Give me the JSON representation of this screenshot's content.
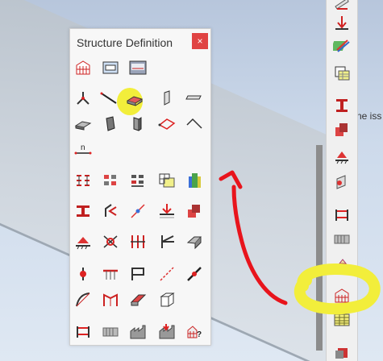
{
  "panel": {
    "title": "Structure Definition",
    "close_label": "×"
  },
  "background": {
    "partial_text": "ne iss"
  },
  "panel_tools": [
    "structure-model-icon",
    "section-view-icon",
    "rob-icon",
    "node-icon",
    "bar-icon",
    "slab-icon",
    "wall-icon",
    "panel-icon",
    "solid-slab-icon",
    "volumetric-icon",
    "beam-icon",
    "contour-icon",
    "edge-icon",
    "node-n-icon",
    "bar-sections-icon",
    "slab-sections-icon",
    "panel-sections-icon",
    "materials-icon",
    "layers-icon",
    "i-section-icon",
    "rotate-icon",
    "releases-icon",
    "loads-icon",
    "shell-icon",
    "supports-icon",
    "offsets-icon",
    "columns-icon",
    "angles-icon",
    "cut-icon",
    "link-icon",
    "piles-icon",
    "contour-panel-icon",
    "diagonal-icon",
    "rigid-link-icon",
    "arch-icon",
    "frame-icon",
    "slope-icon",
    "cube-icon",
    "calculations-icon",
    "grid-icon",
    "factory-icon",
    "factory-loads-icon",
    "help-structure-icon"
  ],
  "right_tools": [
    "fold-icon",
    "load-arrow-icon",
    "colorful-icon",
    "table-icon",
    "i-section-icon",
    "shell-icon",
    "support-icon",
    "shell-edge-icon",
    "calculations-icon",
    "grid-icon",
    "mesh-icon",
    "structure-definition-icon",
    "table-icon",
    "stack-icon"
  ],
  "colors": {
    "highlight": "#f2ee3b",
    "annotation": "#e8141c",
    "close_button": "#e04343"
  }
}
